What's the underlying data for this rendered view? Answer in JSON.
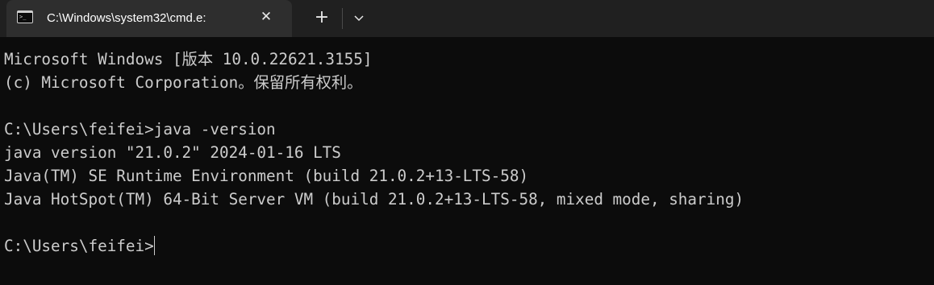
{
  "tab": {
    "title": "C:\\Windows\\system32\\cmd.e:",
    "icon": "command-prompt-icon",
    "close_icon": "close-icon"
  },
  "tabbar": {
    "new_tab_icon": "plus-icon",
    "dropdown_icon": "chevron-down-icon"
  },
  "terminal": {
    "lines": [
      "Microsoft Windows [版本 10.0.22621.3155]",
      "(c) Microsoft Corporation。保留所有权利。",
      "",
      "C:\\Users\\feifei>java -version",
      "java version \"21.0.2\" 2024-01-16 LTS",
      "Java(TM) SE Runtime Environment (build 21.0.2+13-LTS-58)",
      "Java HotSpot(TM) 64-Bit Server VM (build 21.0.2+13-LTS-58, mixed mode, sharing)",
      "",
      "C:\\Users\\feifei>"
    ]
  },
  "colors": {
    "background": "#0c0c0c",
    "tabbar": "#202020",
    "active_tab": "#2e2e2e",
    "text": "#cccccc"
  }
}
